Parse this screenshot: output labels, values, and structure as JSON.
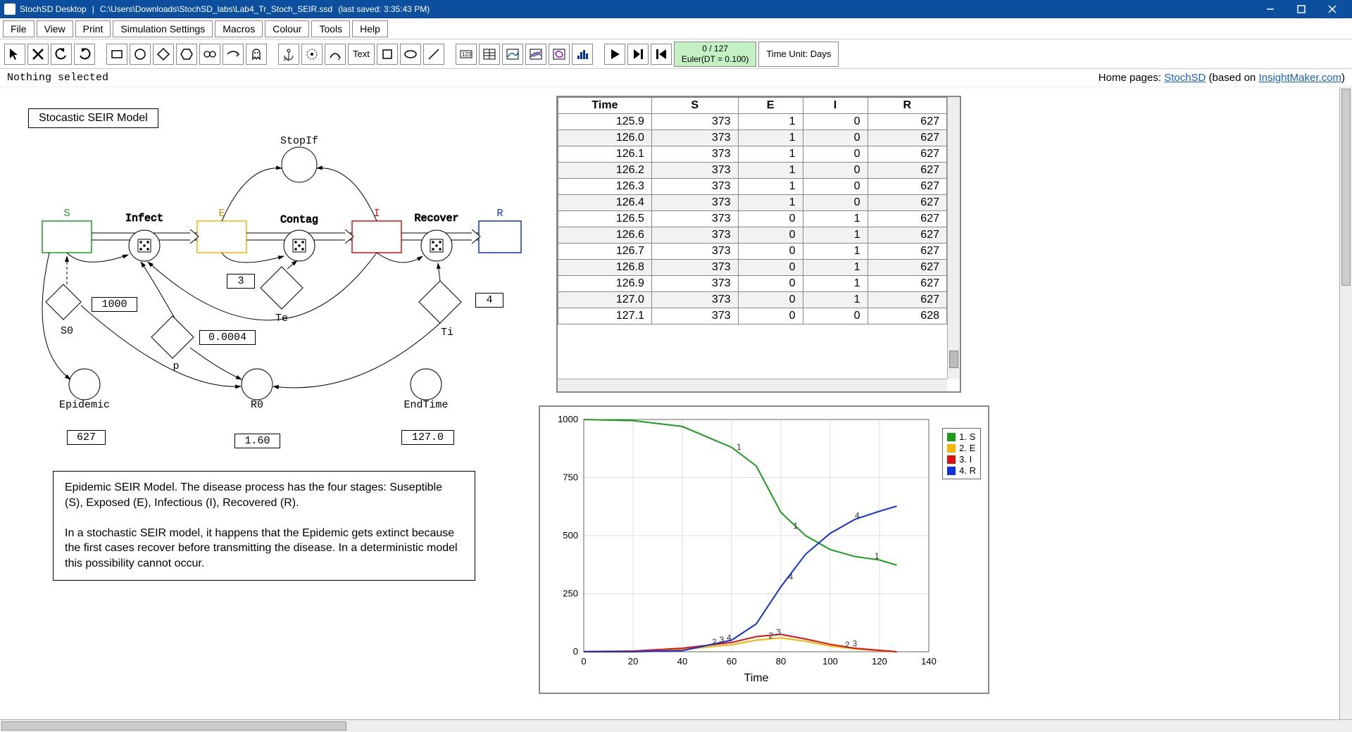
{
  "title": {
    "app": "StochSD Desktop",
    "sep": "|",
    "path": "C:\\Users\\Downloads\\StochSD_labs\\Lab4_Tr_Stoch_SEIR.ssd",
    "saved": "(last saved: 3:35:43 PM)"
  },
  "menu": [
    "File",
    "View",
    "Print",
    "Simulation Settings",
    "Macros",
    "Colour",
    "Tools",
    "Help"
  ],
  "status": {
    "selection": "Nothing selected",
    "home_prefix": "Home pages: ",
    "link1": "StochSD",
    "mid": " (based on ",
    "link2": "InsightMaker.com",
    "suffix": ")"
  },
  "sim": {
    "progress": "0 / 127",
    "solver": "Euler(DT = 0.100)",
    "timeunit": "Time Unit: Days"
  },
  "model": {
    "title": "Stocastic SEIR Model",
    "stocks": {
      "S": "S",
      "E": "E",
      "I": "I",
      "R": "R"
    },
    "flows": {
      "Infect": "Infect",
      "Contag": "Contag",
      "Recover": "Recover"
    },
    "aux": {
      "StopIf": "StopIf",
      "Te": "Te",
      "Ti": "Ti",
      "p": "p",
      "S0": "S0",
      "Epidemic": "Epidemic",
      "R0": "R0",
      "EndTime": "EndTime"
    },
    "vals": {
      "Te": "3",
      "Ti": "4",
      "p": "0.0004",
      "S0": "1000",
      "Epidemic": "627",
      "R0": "1.60",
      "EndTime": "127.0"
    },
    "desc1": "Epidemic SEIR Model. The disease process has the four stages: Suseptible (S), Exposed (E), Infectious (I), Recovered (R).",
    "desc2": "In a stochastic SEIR model, it happens that the Epidemic gets extinct because the first cases recover before transmitting the disease. In a deterministic model this possibility cannot occur."
  },
  "table": {
    "headers": [
      "Time",
      "S",
      "E",
      "I",
      "R"
    ],
    "rows": [
      [
        "125.9",
        "373",
        "1",
        "0",
        "627"
      ],
      [
        "126.0",
        "373",
        "1",
        "0",
        "627"
      ],
      [
        "126.1",
        "373",
        "1",
        "0",
        "627"
      ],
      [
        "126.2",
        "373",
        "1",
        "0",
        "627"
      ],
      [
        "126.3",
        "373",
        "1",
        "0",
        "627"
      ],
      [
        "126.4",
        "373",
        "1",
        "0",
        "627"
      ],
      [
        "126.5",
        "373",
        "0",
        "1",
        "627"
      ],
      [
        "126.6",
        "373",
        "0",
        "1",
        "627"
      ],
      [
        "126.7",
        "373",
        "0",
        "1",
        "627"
      ],
      [
        "126.8",
        "373",
        "0",
        "1",
        "627"
      ],
      [
        "126.9",
        "373",
        "0",
        "1",
        "627"
      ],
      [
        "127.0",
        "373",
        "0",
        "1",
        "627"
      ],
      [
        "127.1",
        "373",
        "0",
        "0",
        "628"
      ]
    ]
  },
  "chart_data": {
    "type": "line",
    "title": "",
    "xlabel": "Time",
    "ylabel": "",
    "xlim": [
      0,
      140
    ],
    "ylim": [
      0,
      1000
    ],
    "xticks": [
      0,
      20,
      40,
      60,
      80,
      100,
      120,
      140
    ],
    "yticks": [
      0,
      250,
      500,
      750,
      1000
    ],
    "series": [
      {
        "name": "1. S",
        "color": "#1a9e1a",
        "x": [
          0,
          20,
          40,
          60,
          70,
          80,
          90,
          100,
          110,
          120,
          127
        ],
        "y": [
          1000,
          995,
          970,
          880,
          800,
          600,
          500,
          440,
          410,
          395,
          373
        ]
      },
      {
        "name": "2. E",
        "color": "#f5b400",
        "x": [
          0,
          20,
          40,
          60,
          70,
          80,
          90,
          100,
          110,
          120,
          127
        ],
        "y": [
          0,
          2,
          10,
          30,
          50,
          60,
          45,
          25,
          12,
          5,
          0
        ]
      },
      {
        "name": "3. I",
        "color": "#e01010",
        "x": [
          0,
          20,
          40,
          60,
          70,
          80,
          90,
          100,
          110,
          120,
          127
        ],
        "y": [
          1,
          3,
          15,
          40,
          65,
          75,
          55,
          32,
          15,
          6,
          0
        ]
      },
      {
        "name": "4. R",
        "color": "#1030e0",
        "x": [
          0,
          20,
          40,
          60,
          70,
          80,
          90,
          100,
          110,
          120,
          127
        ],
        "y": [
          0,
          0,
          5,
          50,
          120,
          280,
          420,
          510,
          570,
          605,
          627
        ]
      }
    ],
    "annotations": [
      {
        "label": "1",
        "x": 62,
        "y": 870
      },
      {
        "label": "1",
        "x": 85,
        "y": 530
      },
      {
        "label": "1",
        "x": 118,
        "y": 400
      },
      {
        "label": "2",
        "x": 52,
        "y": 30
      },
      {
        "label": "2",
        "x": 75,
        "y": 58
      },
      {
        "label": "2",
        "x": 106,
        "y": 18
      },
      {
        "label": "3",
        "x": 55,
        "y": 40
      },
      {
        "label": "3",
        "x": 78,
        "y": 72
      },
      {
        "label": "3",
        "x": 109,
        "y": 22
      },
      {
        "label": "4",
        "x": 58,
        "y": 48
      },
      {
        "label": "4",
        "x": 83,
        "y": 310
      },
      {
        "label": "4",
        "x": 110,
        "y": 575
      }
    ]
  },
  "legend": [
    "1. S",
    "2. E",
    "3. I",
    "4. R"
  ],
  "legend_colors": [
    "#1a9e1a",
    "#f5b400",
    "#e01010",
    "#1030e0"
  ]
}
